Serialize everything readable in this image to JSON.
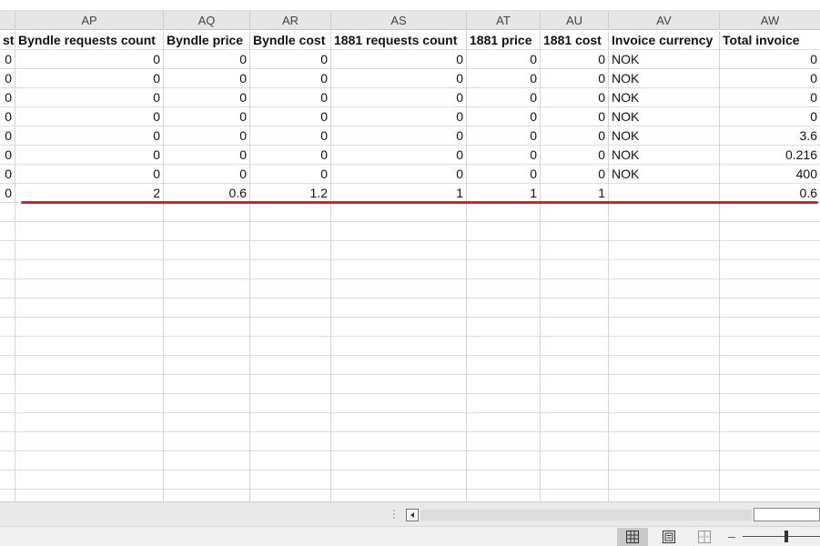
{
  "columns": [
    "AP",
    "AQ",
    "AR",
    "AS",
    "AT",
    "AU",
    "AV",
    "AW"
  ],
  "headers": {
    "partial": "st",
    "cells": [
      "Byndle requests count",
      "Byndle price",
      "Byndle cost",
      "1881 requests count",
      "1881 price",
      "1881 cost",
      "Invoice currency",
      "Total invoice"
    ]
  },
  "rows": [
    {
      "partial": "0",
      "cells": [
        "0",
        "0",
        "0",
        "0",
        "0",
        "0",
        "NOK",
        "0"
      ]
    },
    {
      "partial": "0",
      "cells": [
        "0",
        "0",
        "0",
        "0",
        "0",
        "0",
        "NOK",
        "0"
      ]
    },
    {
      "partial": "0",
      "cells": [
        "0",
        "0",
        "0",
        "0",
        "0",
        "0",
        "NOK",
        "0"
      ]
    },
    {
      "partial": "0",
      "cells": [
        "0",
        "0",
        "0",
        "0",
        "0",
        "0",
        "NOK",
        "0"
      ]
    },
    {
      "partial": "0",
      "cells": [
        "0",
        "0",
        "0",
        "0",
        "0",
        "0",
        "NOK",
        "3.6"
      ]
    },
    {
      "partial": "0",
      "cells": [
        "0",
        "0",
        "0",
        "0",
        "0",
        "0",
        "NOK",
        "0.216"
      ]
    },
    {
      "partial": "0",
      "cells": [
        "0",
        "0",
        "0",
        "0",
        "0",
        "0",
        "NOK",
        "400"
      ]
    },
    {
      "partial": "0",
      "cells": [
        "2",
        "0.6",
        "1.2",
        "1",
        "1",
        "1",
        "",
        "0.6"
      ]
    }
  ],
  "annotation": {
    "underline_color": "#d8202c"
  },
  "statusbar": {
    "views": [
      "normal-view-icon",
      "page-layout-icon",
      "page-break-preview-icon"
    ],
    "zoom_minus": "–"
  }
}
